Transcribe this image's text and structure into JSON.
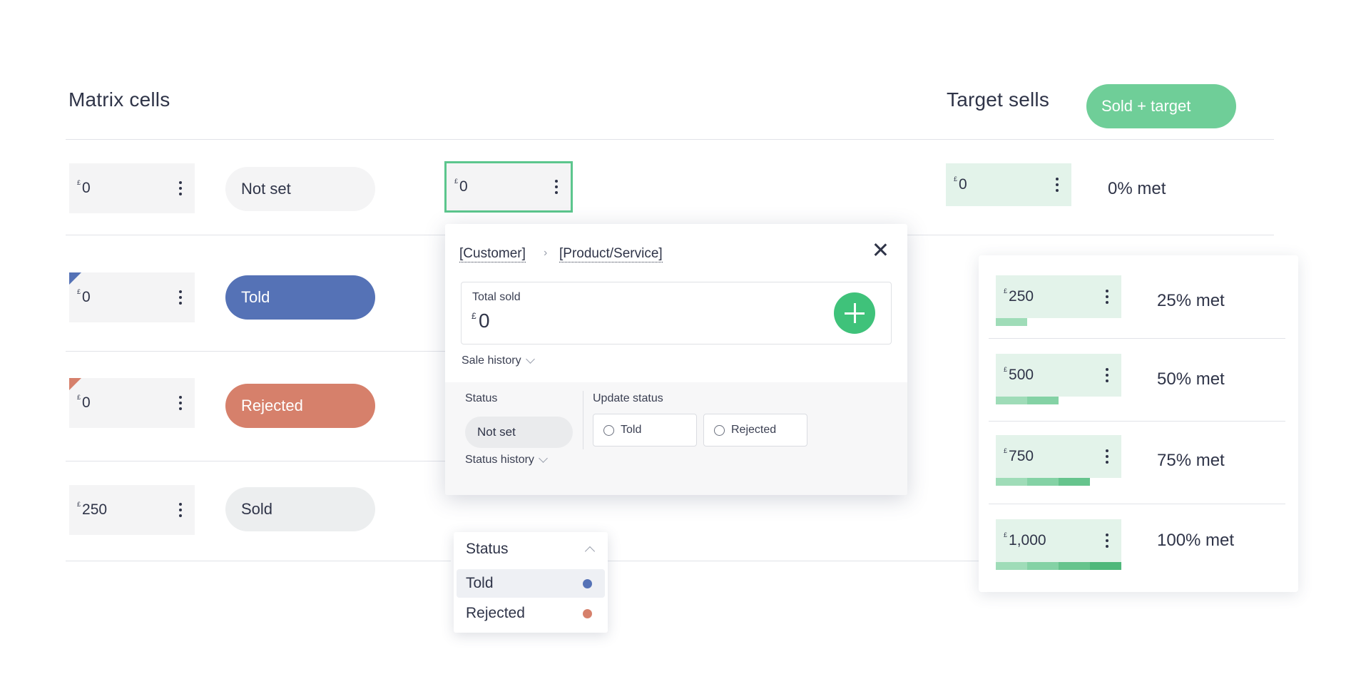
{
  "headings": {
    "matrix_cells": "Matrix cells",
    "target_sells": "Target sells",
    "legend": "Sold + target"
  },
  "rows": [
    {
      "currency": "£",
      "value": "0",
      "status": "Not set"
    },
    {
      "currency": "£",
      "value": "0",
      "status": "Told",
      "corner_color": "#5572b6"
    },
    {
      "currency": "£",
      "value": "0",
      "status": "Rejected",
      "corner_color": "#d6806b"
    },
    {
      "currency": "£",
      "value": "250",
      "status": "Sold"
    }
  ],
  "active_cell": {
    "currency": "£",
    "value": "0"
  },
  "target_row": {
    "currency": "£",
    "value": "0",
    "met": "0% met"
  },
  "popover": {
    "breadcrumb": [
      "[Customer]",
      "[Product/Service]"
    ],
    "total_sold_label": "Total sold",
    "total_currency": "£",
    "total_value": "0",
    "sale_history": "Sale history",
    "status_label": "Status",
    "status_value": "Not set",
    "update_status_label": "Update status",
    "options": [
      "Told",
      "Rejected"
    ],
    "status_history": "Status history"
  },
  "dropdown": {
    "label": "Status",
    "items": [
      {
        "label": "Told",
        "color": "#5572b6"
      },
      {
        "label": "Rejected",
        "color": "#d6806b"
      }
    ]
  },
  "targets": [
    {
      "currency": "£",
      "value": "250",
      "met": "25% met",
      "progress": 0.25
    },
    {
      "currency": "£",
      "value": "500",
      "met": "50% met",
      "progress": 0.5
    },
    {
      "currency": "£",
      "value": "750",
      "met": "75% met",
      "progress": 0.75
    },
    {
      "currency": "£",
      "value": "1,000",
      "met": "100% met",
      "progress": 1.0
    }
  ],
  "colors": {
    "accent_green": "#3fc27a",
    "legend_green": "#6fce98",
    "told_blue": "#5572b6",
    "rejected_orange": "#d6806b",
    "progress_shades": [
      "#9fdcb8",
      "#84d2a5",
      "#66c48d",
      "#4fb87b"
    ]
  }
}
